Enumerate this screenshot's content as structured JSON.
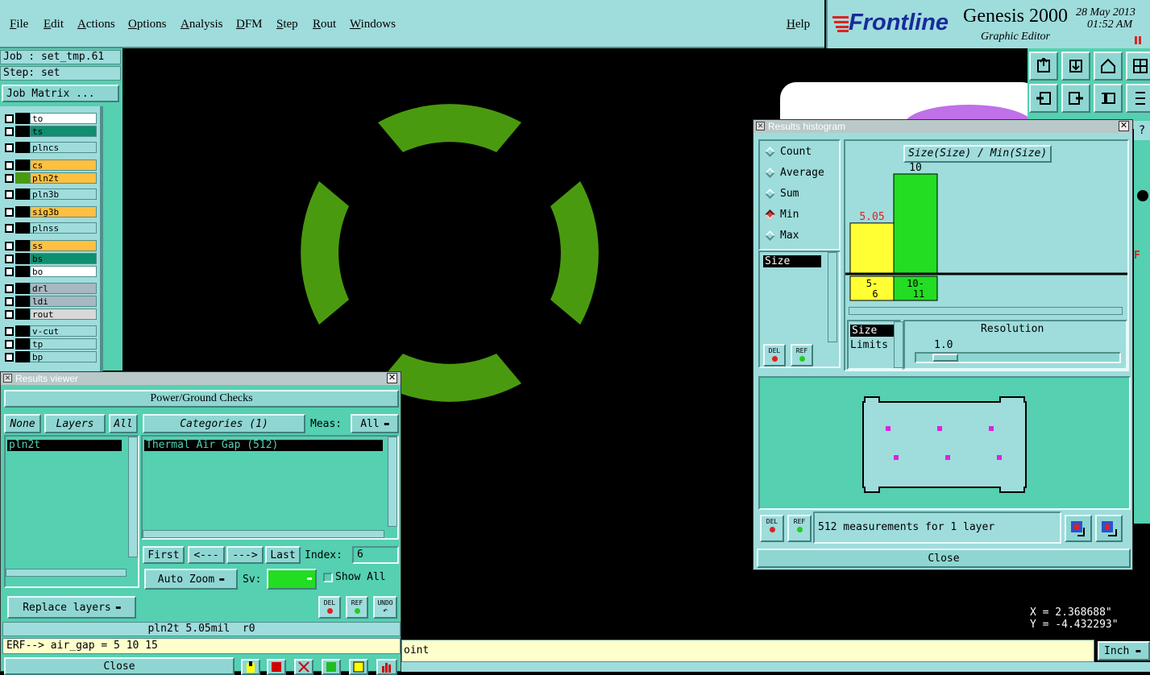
{
  "menu": {
    "items": [
      "File",
      "Edit",
      "Actions",
      "Options",
      "Analysis",
      "DFM",
      "Step",
      "Rout",
      "Windows"
    ],
    "help": "Help"
  },
  "brand": {
    "logo": "Frontline",
    "product": "Genesis 2000",
    "subtitle": "Graphic Editor",
    "date": "28 May 2013",
    "time": "01:52 AM"
  },
  "job": {
    "job_label": "Job : set_tmp.61",
    "step_label": "Step: set",
    "matrix_button": "Job Matrix ..."
  },
  "layers": [
    {
      "name": "to",
      "color": "#ffffff"
    },
    {
      "name": "ts",
      "color": "#0f8f6f"
    },
    {
      "name": "plncs",
      "color": "#9fdcdc"
    },
    {
      "name": "cs",
      "color": "#ffc040"
    },
    {
      "name": "pln2t",
      "color": "#ffc040"
    },
    {
      "name": "pln3b",
      "color": "#9fdcdc"
    },
    {
      "name": "sig3b",
      "color": "#ffc040"
    },
    {
      "name": "plnss",
      "color": "#9fdcdc"
    },
    {
      "name": "ss",
      "color": "#ffc040"
    },
    {
      "name": "bs",
      "color": "#0f8f6f"
    },
    {
      "name": "bo",
      "color": "#ffffff"
    },
    {
      "name": "drl",
      "color": "#a8b8c0"
    },
    {
      "name": "ldi",
      "color": "#a8b8c0"
    },
    {
      "name": "rout",
      "color": "#d8d8d8"
    },
    {
      "name": "v-cut",
      "color": "#9fdcdc"
    },
    {
      "name": "tp",
      "color": "#9fdcdc"
    },
    {
      "name": "bp",
      "color": "#9fdcdc"
    }
  ],
  "results_viewer": {
    "title": "Results viewer",
    "header": "Power/Ground Checks",
    "none_label": "None",
    "layers_label": "Layers",
    "all_label": "All",
    "categories_label": "Categories (1)",
    "meas_label": "Meas:",
    "meas_value": "All",
    "layer_items": [
      "pln2t"
    ],
    "category_items": [
      "Thermal Air Gap (512)"
    ],
    "first": "First",
    "prev": "<---",
    "next": "--->",
    "last": "Last",
    "index_label": "Index:",
    "index_value": "6",
    "auto_zoom": "Auto Zoom",
    "sv_label": "Sv:",
    "show_all": "Show All",
    "replace_layers": "Replace layers",
    "del": "DEL",
    "ref": "REF",
    "undo": "UNDO",
    "status": "pln2t 5.05mil  r0",
    "close": "Close"
  },
  "erf_line": "ERF--> air_gap = 5 10 15",
  "command_line_text": "oint",
  "histogram": {
    "title": "Results histogram",
    "modes": [
      "Count",
      "Average",
      "Sum",
      "Min",
      "Max"
    ],
    "selected_mode": "Min",
    "list_items": [
      "Size"
    ],
    "chart_title": "Size(Size) / Min(Size)",
    "bins": [
      {
        "label_top": "5-",
        "label_bot": "6",
        "value": 5.05,
        "value_label": "5.05",
        "color": "#ffff33",
        "label_color": "#dd2222"
      },
      {
        "label_top": "10-",
        "label_bot": "11",
        "value": 10,
        "value_label": "10",
        "color": "#22dd22",
        "label_color": "#000000"
      }
    ],
    "param_items": [
      "Size",
      "Limits"
    ],
    "resolution_label": "Resolution",
    "resolution_value": "1.0",
    "del": "DEL",
    "ref": "REF",
    "measurements": "512 measurements for 1 layer",
    "close": "Close"
  },
  "coords": {
    "x": "X = 2.368688\"",
    "y": "Y = -4.432293\""
  },
  "units": "Inch",
  "colors": {
    "panel": "#9fdcdc",
    "teal": "#55d0b0",
    "thermal": "#4a9a10",
    "magenta": "#dd22dd"
  }
}
